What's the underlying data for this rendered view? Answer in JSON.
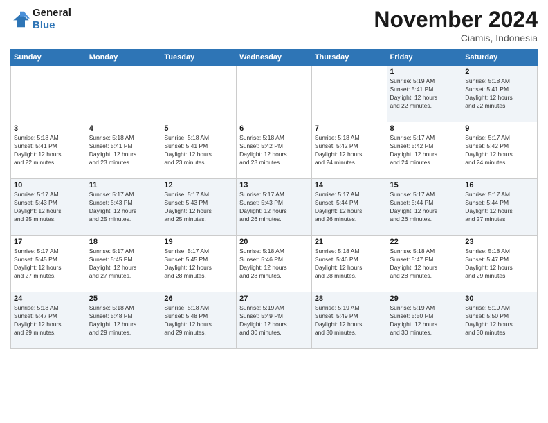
{
  "logo": {
    "line1": "General",
    "line2": "Blue"
  },
  "header": {
    "title": "November 2024",
    "subtitle": "Ciamis, Indonesia"
  },
  "weekdays": [
    "Sunday",
    "Monday",
    "Tuesday",
    "Wednesday",
    "Thursday",
    "Friday",
    "Saturday"
  ],
  "weeks": [
    [
      {
        "day": "",
        "info": ""
      },
      {
        "day": "",
        "info": ""
      },
      {
        "day": "",
        "info": ""
      },
      {
        "day": "",
        "info": ""
      },
      {
        "day": "",
        "info": ""
      },
      {
        "day": "1",
        "info": "Sunrise: 5:19 AM\nSunset: 5:41 PM\nDaylight: 12 hours\nand 22 minutes."
      },
      {
        "day": "2",
        "info": "Sunrise: 5:18 AM\nSunset: 5:41 PM\nDaylight: 12 hours\nand 22 minutes."
      }
    ],
    [
      {
        "day": "3",
        "info": "Sunrise: 5:18 AM\nSunset: 5:41 PM\nDaylight: 12 hours\nand 22 minutes."
      },
      {
        "day": "4",
        "info": "Sunrise: 5:18 AM\nSunset: 5:41 PM\nDaylight: 12 hours\nand 23 minutes."
      },
      {
        "day": "5",
        "info": "Sunrise: 5:18 AM\nSunset: 5:41 PM\nDaylight: 12 hours\nand 23 minutes."
      },
      {
        "day": "6",
        "info": "Sunrise: 5:18 AM\nSunset: 5:42 PM\nDaylight: 12 hours\nand 23 minutes."
      },
      {
        "day": "7",
        "info": "Sunrise: 5:18 AM\nSunset: 5:42 PM\nDaylight: 12 hours\nand 24 minutes."
      },
      {
        "day": "8",
        "info": "Sunrise: 5:17 AM\nSunset: 5:42 PM\nDaylight: 12 hours\nand 24 minutes."
      },
      {
        "day": "9",
        "info": "Sunrise: 5:17 AM\nSunset: 5:42 PM\nDaylight: 12 hours\nand 24 minutes."
      }
    ],
    [
      {
        "day": "10",
        "info": "Sunrise: 5:17 AM\nSunset: 5:43 PM\nDaylight: 12 hours\nand 25 minutes."
      },
      {
        "day": "11",
        "info": "Sunrise: 5:17 AM\nSunset: 5:43 PM\nDaylight: 12 hours\nand 25 minutes."
      },
      {
        "day": "12",
        "info": "Sunrise: 5:17 AM\nSunset: 5:43 PM\nDaylight: 12 hours\nand 25 minutes."
      },
      {
        "day": "13",
        "info": "Sunrise: 5:17 AM\nSunset: 5:43 PM\nDaylight: 12 hours\nand 26 minutes."
      },
      {
        "day": "14",
        "info": "Sunrise: 5:17 AM\nSunset: 5:44 PM\nDaylight: 12 hours\nand 26 minutes."
      },
      {
        "day": "15",
        "info": "Sunrise: 5:17 AM\nSunset: 5:44 PM\nDaylight: 12 hours\nand 26 minutes."
      },
      {
        "day": "16",
        "info": "Sunrise: 5:17 AM\nSunset: 5:44 PM\nDaylight: 12 hours\nand 27 minutes."
      }
    ],
    [
      {
        "day": "17",
        "info": "Sunrise: 5:17 AM\nSunset: 5:45 PM\nDaylight: 12 hours\nand 27 minutes."
      },
      {
        "day": "18",
        "info": "Sunrise: 5:17 AM\nSunset: 5:45 PM\nDaylight: 12 hours\nand 27 minutes."
      },
      {
        "day": "19",
        "info": "Sunrise: 5:17 AM\nSunset: 5:45 PM\nDaylight: 12 hours\nand 28 minutes."
      },
      {
        "day": "20",
        "info": "Sunrise: 5:18 AM\nSunset: 5:46 PM\nDaylight: 12 hours\nand 28 minutes."
      },
      {
        "day": "21",
        "info": "Sunrise: 5:18 AM\nSunset: 5:46 PM\nDaylight: 12 hours\nand 28 minutes."
      },
      {
        "day": "22",
        "info": "Sunrise: 5:18 AM\nSunset: 5:47 PM\nDaylight: 12 hours\nand 28 minutes."
      },
      {
        "day": "23",
        "info": "Sunrise: 5:18 AM\nSunset: 5:47 PM\nDaylight: 12 hours\nand 29 minutes."
      }
    ],
    [
      {
        "day": "24",
        "info": "Sunrise: 5:18 AM\nSunset: 5:47 PM\nDaylight: 12 hours\nand 29 minutes."
      },
      {
        "day": "25",
        "info": "Sunrise: 5:18 AM\nSunset: 5:48 PM\nDaylight: 12 hours\nand 29 minutes."
      },
      {
        "day": "26",
        "info": "Sunrise: 5:18 AM\nSunset: 5:48 PM\nDaylight: 12 hours\nand 29 minutes."
      },
      {
        "day": "27",
        "info": "Sunrise: 5:19 AM\nSunset: 5:49 PM\nDaylight: 12 hours\nand 30 minutes."
      },
      {
        "day": "28",
        "info": "Sunrise: 5:19 AM\nSunset: 5:49 PM\nDaylight: 12 hours\nand 30 minutes."
      },
      {
        "day": "29",
        "info": "Sunrise: 5:19 AM\nSunset: 5:50 PM\nDaylight: 12 hours\nand 30 minutes."
      },
      {
        "day": "30",
        "info": "Sunrise: 5:19 AM\nSunset: 5:50 PM\nDaylight: 12 hours\nand 30 minutes."
      }
    ]
  ]
}
